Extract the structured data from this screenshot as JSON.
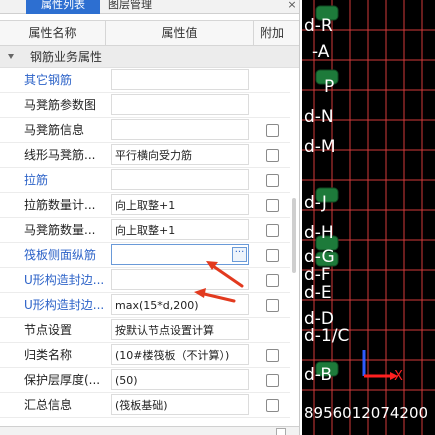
{
  "tabs": {
    "properties": "属性列表",
    "layers": "图层管理",
    "close": "×"
  },
  "table_header": {
    "name": "属性名称",
    "value": "属性值",
    "add": "附加"
  },
  "group": {
    "title": "钢筋业务属性"
  },
  "rows": [
    {
      "name": "其它钢筋",
      "value": ""
    },
    {
      "name": "马凳筋参数图",
      "value": ""
    },
    {
      "name": "马凳筋信息",
      "value": ""
    },
    {
      "name": "线形马凳筋...",
      "value": "平行横向受力筋"
    },
    {
      "name": "拉筋",
      "value": ""
    },
    {
      "name": "拉筋数量计...",
      "value": "向上取整+1"
    },
    {
      "name": "马凳筋数量...",
      "value": "向上取整+1"
    },
    {
      "name": "筏板侧面纵筋",
      "value": "",
      "button": "···"
    },
    {
      "name": "U形构造封边...",
      "value": ""
    },
    {
      "name": "U形构造封边...",
      "value": "max(15*d,200)"
    },
    {
      "name": "节点设置",
      "value": "按默认节点设置计算"
    },
    {
      "name": "归类名称",
      "value": "(10#楼筏板（不计算）)"
    },
    {
      "name": "保护层厚度(...",
      "value": "(50)"
    },
    {
      "name": "汇总信息",
      "value": "(筏板基础)"
    }
  ],
  "canvas": {
    "labels": [
      "d-R",
      "-A",
      "P",
      "d-N",
      "d-M",
      "d-J",
      "d-H",
      "d-G",
      "d-F",
      "d-E",
      "d-D",
      "d-1/C",
      "d-B"
    ],
    "axis_label": "X",
    "bottom_text": "8956012074200",
    "colors": {
      "background": "#000000",
      "grid": "#d23a3a",
      "label": "#ffffff",
      "marker": "#1d7a3a",
      "axis_x": "#ff2020",
      "axis_y": "#2f5cff"
    }
  },
  "colors": {
    "accent": "#2d6fd1",
    "link_text": "#2d63c8",
    "annotation_arrow": "#e23a1f"
  }
}
